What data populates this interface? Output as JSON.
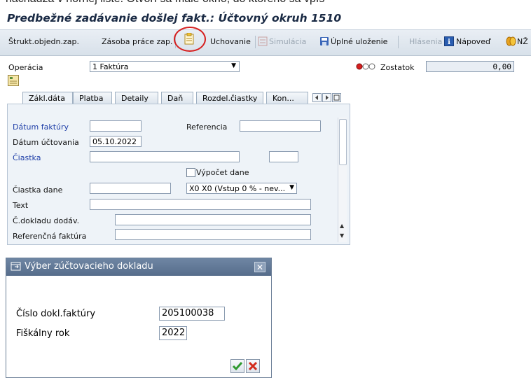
{
  "doc_text": "nachádza v hornej lište. Otvorí sa malé okno, do ktorého sa vpíš",
  "window_title": "Predbežné zadávanie došlej fakt.: Účtovný okruh 1510",
  "toolbar": {
    "items": [
      "Štrukt.objedn.zap.",
      "Zásoba práce zap.",
      "Uchovanie",
      "Simulácia",
      "Úplné uloženie",
      "Hlásenia",
      "Nápoveď",
      "NŽ"
    ]
  },
  "operation": {
    "label": "Operácia",
    "value": "1 Faktúra"
  },
  "balance": {
    "label": "Zostatok",
    "value": "0,00"
  },
  "tabs": [
    "Zákl.dáta",
    "Platba",
    "Detaily",
    "Daň",
    "Rozdel.čiastky",
    "Kon..."
  ],
  "form": {
    "invoice_date_label": "Dátum faktúry",
    "invoice_date_value": "",
    "reference_label": "Referencia",
    "reference_value": "",
    "posting_date_label": "Dátum účtovania",
    "posting_date_value": "05.10.2022",
    "amount_label": "Čiastka",
    "amount_value": "",
    "calc_tax_label": "Výpočet dane",
    "tax_amount_label": "Čiastka dane",
    "tax_code_value": "X0 X0 (Vstup 0 % - nev...",
    "text_label": "Text",
    "vendor_doc_label": "Č.dokladu dodáv.",
    "ref_invoice_label": "Referenčná faktúra"
  },
  "dialog": {
    "title": "Výber zúčtovacieho dokladu",
    "invoice_no_label": "Číslo dokl.faktúry",
    "invoice_no_value": "205100038",
    "fiscal_year_label": "Fiškálny rok",
    "fiscal_year_value": "2022"
  },
  "colors": {
    "accent": "#1f3fa8",
    "highlight": "#d62020",
    "dialog_header": "#6f86a3"
  }
}
